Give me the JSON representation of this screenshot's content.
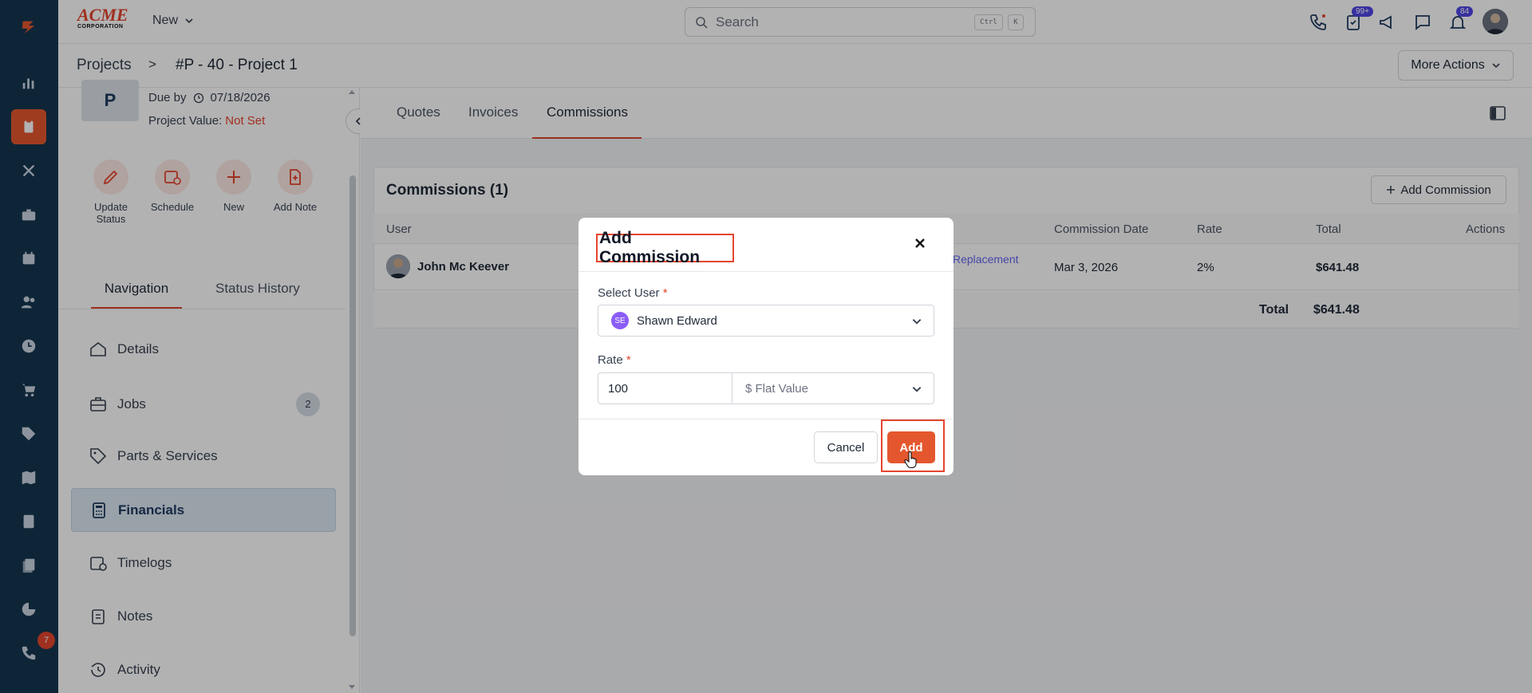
{
  "app": {
    "logo_text": "ACME",
    "logo_sub": "CORPORATION",
    "new_label": "New",
    "search_placeholder": "Search",
    "kbd_ctrl": "Ctrl",
    "kbd_k": "K",
    "tasks_badge": "99+",
    "notifications_badge": "84",
    "calls_badge": "7",
    "more_actions_label": "More Actions"
  },
  "breadcrumb": {
    "root": "Projects",
    "separator": ">",
    "current": "#P - 40 - Project 1"
  },
  "project": {
    "initial": "P",
    "due_label": "Due by",
    "due_date": "07/18/2026",
    "value_label": "Project Value:",
    "value": "Not Set"
  },
  "quick_actions": [
    {
      "label_1": "Update",
      "label_2": "Status"
    },
    {
      "label_1": "Schedule",
      "label_2": ""
    },
    {
      "label_1": "New",
      "label_2": ""
    },
    {
      "label_1": "Add Note",
      "label_2": ""
    }
  ],
  "panel_tabs": {
    "navigation": "Navigation",
    "status_history": "Status History"
  },
  "nav": [
    {
      "label": "Details",
      "count": ""
    },
    {
      "label": "Jobs",
      "count": "2"
    },
    {
      "label": "Parts & Services",
      "count": ""
    },
    {
      "label": "Financials",
      "count": ""
    },
    {
      "label": "Timelogs",
      "count": ""
    },
    {
      "label": "Notes",
      "count": ""
    },
    {
      "label": "Activity",
      "count": ""
    }
  ],
  "main_tabs": [
    {
      "label": "Quotes"
    },
    {
      "label": "Invoices"
    },
    {
      "label": "Commissions"
    }
  ],
  "commissions": {
    "title": "Commissions (1)",
    "add_button": "Add Commission",
    "columns": {
      "user": "User",
      "commission_date": "Commission Date",
      "rate": "Rate",
      "total": "Total",
      "actions": "Actions"
    },
    "rows": [
      {
        "user": "John Mc Keever",
        "link_text": "Replacement",
        "date": "Mar 3, 2026",
        "rate": "2%",
        "total": "$641.48"
      }
    ],
    "footer_label": "Total",
    "footer_total": "$641.48"
  },
  "modal": {
    "title": "Add Commission",
    "select_user_label": "Select User",
    "required_mark": "*",
    "selected_user_initials": "SE",
    "selected_user": "Shawn Edward",
    "rate_label": "Rate",
    "rate_value": "100",
    "rate_type": "$ Flat Value",
    "cancel_label": "Cancel",
    "add_label": "Add"
  },
  "colors": {
    "accent": "#e4572e",
    "rail": "#13354f",
    "link": "#6366f1"
  }
}
